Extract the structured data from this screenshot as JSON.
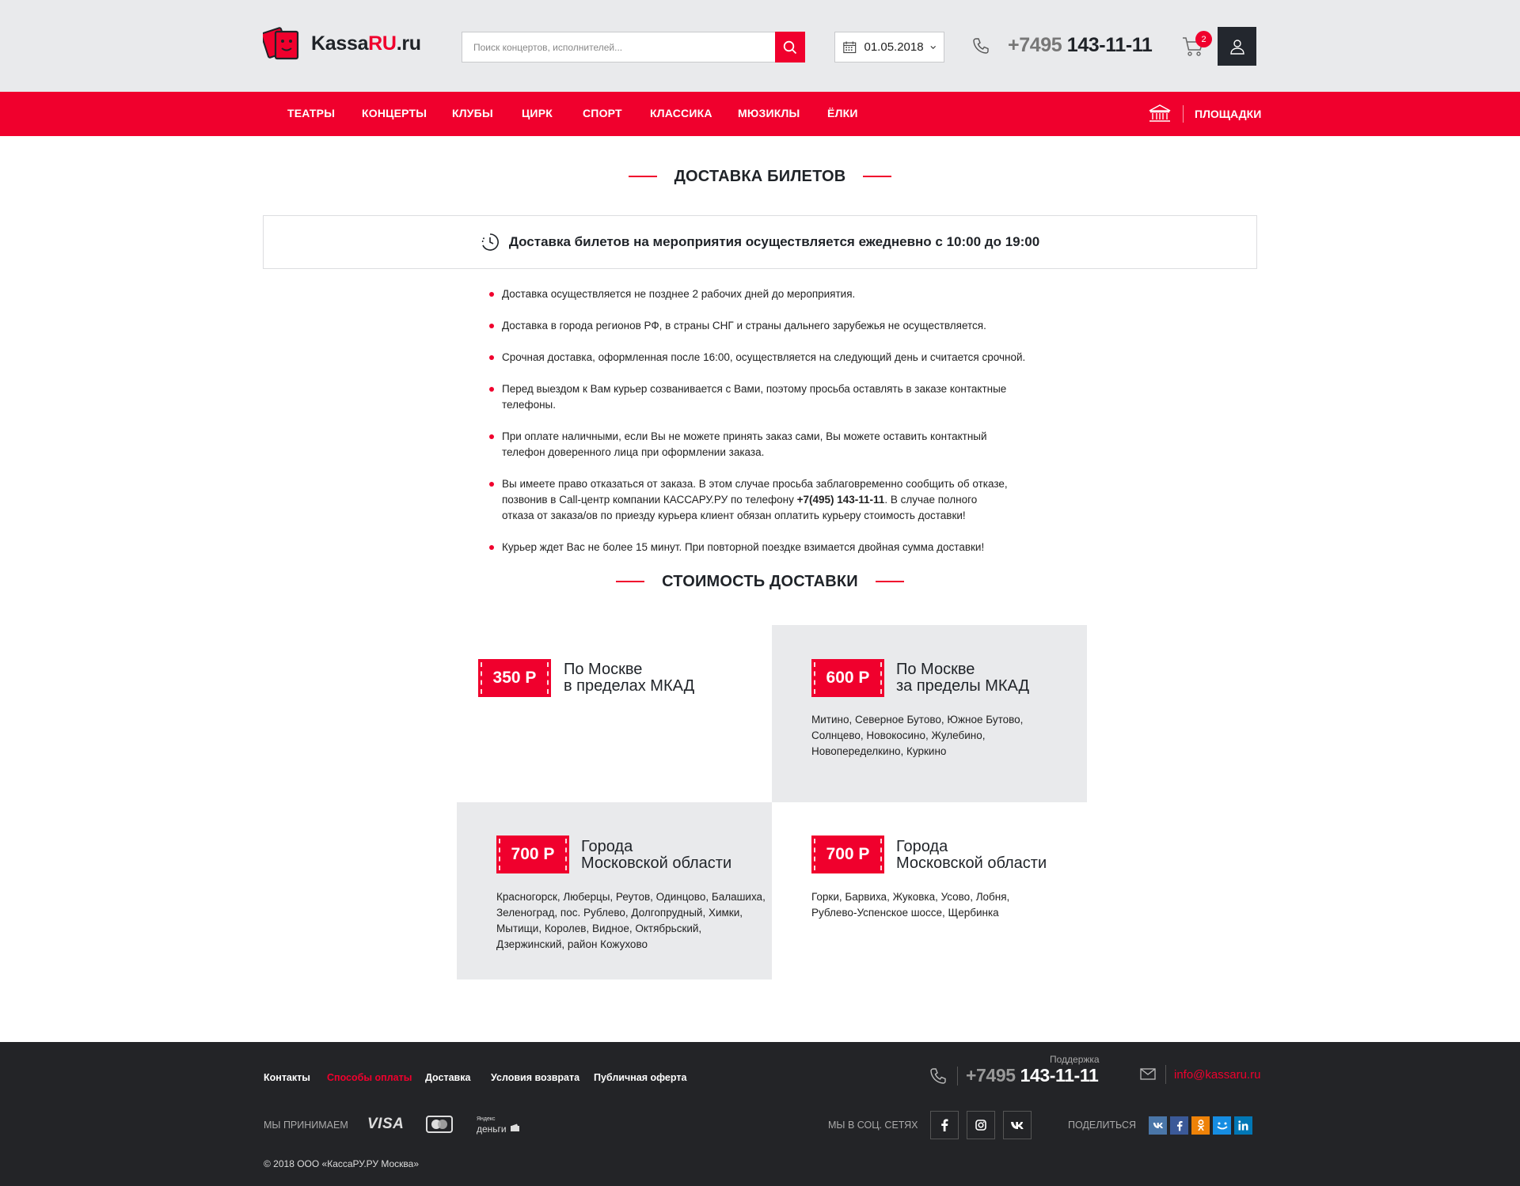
{
  "header": {
    "logo": {
      "text_main": "Kassa",
      "text_accent": "RU",
      "text_suffix": ".ru"
    },
    "search": {
      "placeholder": "Поиск концертов, исполнителей..."
    },
    "date": "01.05.2018",
    "phone": {
      "prefix": "+7495",
      "number": "143-11-11"
    },
    "cart_count": "2"
  },
  "nav": {
    "items": [
      "ТЕАТРЫ",
      "КОНЦЕРТЫ",
      "КЛУБЫ",
      "ЦИРК",
      "СПОРТ",
      "КЛАССИКА",
      "МЮЗИКЛЫ",
      "ЁЛКИ"
    ],
    "venues_label": "ПЛОЩАДКИ"
  },
  "delivery": {
    "title": "ДОСТАВКА БИЛЕТОВ",
    "notice": "Доставка билетов на мероприятия осуществляется ежедневно с 10:00 до 19:00",
    "rules": [
      "Доставка осуществляется не позднее 2 рабочих дней до мероприятия.",
      "Доставка в города регионов РФ, в страны СНГ и страны дальнего зарубежья не осуществляется.",
      "Срочная доставка, оформленная после 16:00, осуществляется на следующий день и считается срочной.",
      "Перед выездом к Вам курьер созванивается с Вами, поэтому просьба оставлять в заказе контактные телефоны.",
      "При оплате наличными, если Вы не можете принять заказ сами, Вы можете оставить контактный телефон доверенного лица при оформлении заказа.",
      {
        "before": "Вы имеете право отказаться от заказа. В этом случае просьба заблаговременно сообщить об отказе, позвонив в Call-центр компании КАССАРУ.РУ по телефону ",
        "bold": "+7(495) 143-11-11",
        "after": ". В случае полного отказа от заказа/ов по приезду курьера клиент обязан оплатить курьеру стоимость доставки!"
      },
      "Курьер ждет Вас не более 15 минут. При повторной поездке взимается двойная сумма доставки!"
    ]
  },
  "cost": {
    "title": "СТОИМОСТЬ ДОСТАВКИ",
    "zones": [
      {
        "price": "350 Р",
        "line1": "По Москве",
        "line2": "в пределах МКАД",
        "places": ""
      },
      {
        "price": "600 Р",
        "line1": "По Москве",
        "line2": "за пределы МКАД",
        "places": "Митино, Северное Бутово, Южное Бутово, Солнцево, Новокосино, Жулебино, Новопеределкино, Куркино"
      },
      {
        "price": "700 Р",
        "line1": "Города",
        "line2": "Московской области",
        "places": "Красногорск, Люберцы, Реутов, Одинцово, Балашиха, Зеленоград, пос. Рублево, Долгопрудный, Химки, Мытищи, Королев, Видное, Октябрьский, Дзержинский, район Кожухово"
      },
      {
        "price": "700 Р",
        "line1": "Города",
        "line2": "Московской области",
        "places": "Горки, Барвиха, Жуковка, Усово, Лобня, Рублево-Успенское шоссе, Щербинка"
      }
    ]
  },
  "footer": {
    "links": [
      "Контакты",
      "Способы оплаты",
      "Доставка",
      "Условия возврата",
      "Публичная оферта"
    ],
    "support_label": "Поддержка",
    "phone": {
      "prefix": "+7495",
      "number": "143-11-11"
    },
    "email": "info@kassaru.ru",
    "accept_label": "МЫ ПРИНИМАЕМ",
    "payments": {
      "visa": "VISA",
      "yandex_small": "Яндекс",
      "yandex_big": "деньги"
    },
    "social_label": "МЫ В СОЦ. СЕТЯХ",
    "share_label": "ПОДЕЛИТЬСЯ",
    "social_icons": [
      "facebook-icon",
      "instagram-icon",
      "vk-icon"
    ],
    "share_icons": [
      "vk-icon",
      "facebook-icon",
      "odnoklassniki-icon",
      "moimir-icon",
      "linkedin-icon"
    ],
    "copyright": "© 2018 ООО «КассаРУ.РУ Москва»"
  },
  "colors": {
    "accent": "#f0002d",
    "dark": "#232427",
    "header_bg": "#e9eaec"
  }
}
